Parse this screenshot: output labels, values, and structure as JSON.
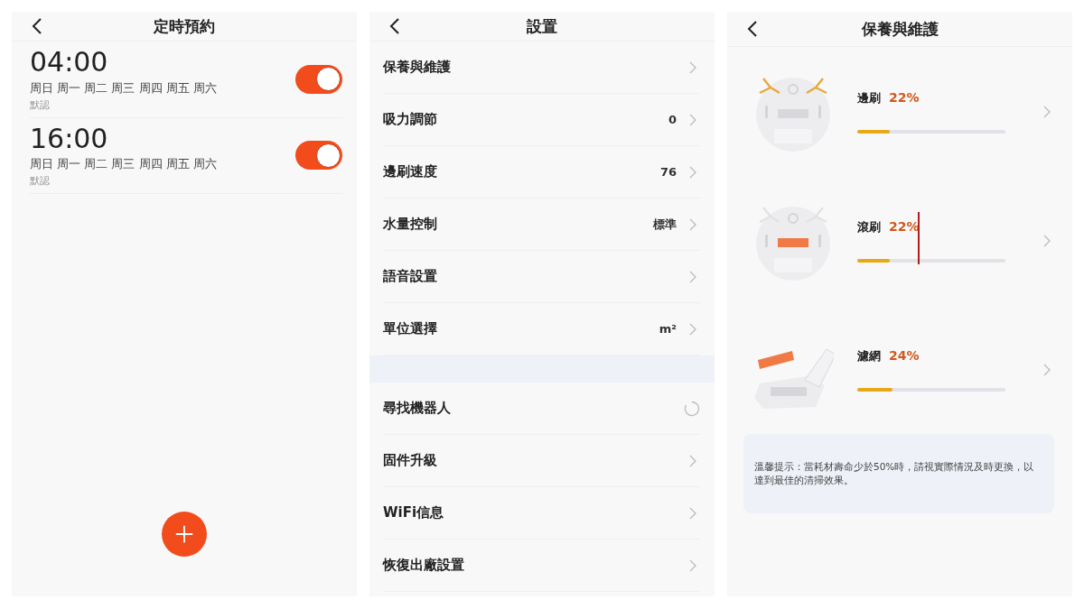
{
  "schedule": {
    "title": "定時預約",
    "items": [
      {
        "time": "04:00",
        "days": "周日 周一 周二 周三 周四 周五 周六",
        "note": "默認",
        "on": true
      },
      {
        "time": "16:00",
        "days": "周日 周一 周二 周三 周四 周五 周六",
        "note": "默認",
        "on": true
      }
    ]
  },
  "settings": {
    "title": "設置",
    "groups": [
      [
        {
          "label": "保養與維護",
          "kind": "chevron"
        },
        {
          "label": "吸力調節",
          "value": "0",
          "kind": "chevron"
        },
        {
          "label": "邊刷速度",
          "value": "76",
          "kind": "chevron"
        },
        {
          "label": "水量控制",
          "value": "標準",
          "kind": "chevron"
        },
        {
          "label": "語音設置",
          "kind": "chevron"
        },
        {
          "label": "單位選擇",
          "value": "m²",
          "kind": "chevron"
        }
      ],
      [
        {
          "label": "尋找機器人",
          "kind": "spinner"
        },
        {
          "label": "固件升級",
          "kind": "chevron"
        },
        {
          "label": "WiFi信息",
          "kind": "chevron"
        },
        {
          "label": "恢復出廠設置",
          "kind": "chevron"
        }
      ]
    ]
  },
  "maintenance": {
    "title": "保養與維護",
    "items": [
      {
        "name": "邊刷",
        "percent": "22%",
        "level": 0.22,
        "kind": "side-brush"
      },
      {
        "name": "滾刷",
        "percent": "22%",
        "level": 0.22,
        "kind": "main-brush"
      },
      {
        "name": "濾網",
        "percent": "24%",
        "level": 0.24,
        "kind": "filter"
      }
    ],
    "tip": "溫馨提示：當耗材壽命少於50%時，請視實際情況及時更換，以達到最佳的清掃效果。"
  }
}
